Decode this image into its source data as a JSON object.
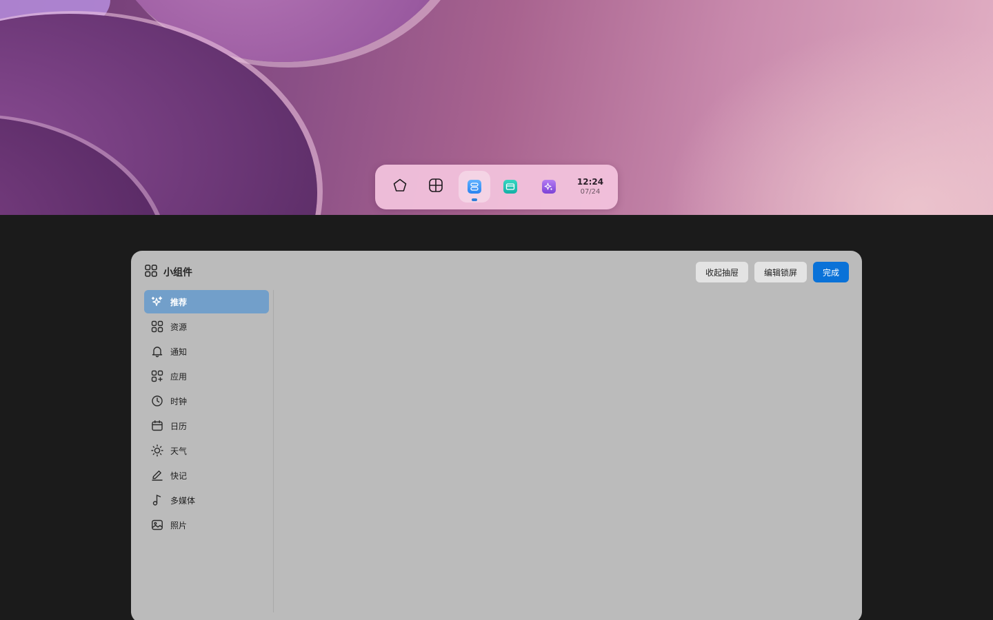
{
  "dock": {
    "items": [
      {
        "icon": "pentagon-icon"
      },
      {
        "icon": "grid-icon"
      },
      {
        "icon": "widgets-icon",
        "active": true
      },
      {
        "icon": "card-icon"
      },
      {
        "icon": "sparkle-icon"
      }
    ],
    "clock": {
      "time": "12:24",
      "date": "07/24"
    }
  },
  "panel": {
    "title": "小组件",
    "actions": {
      "collapse_label": "收起抽屉",
      "edit_lock_label": "编辑锁屏",
      "done_label": "完成"
    },
    "sidebar": {
      "items": [
        {
          "label": "推荐",
          "icon": "sparkle-icon",
          "active": true
        },
        {
          "label": "资源",
          "icon": "grid-icon"
        },
        {
          "label": "通知",
          "icon": "bell-icon"
        },
        {
          "label": "应用",
          "icon": "apps-add-icon"
        },
        {
          "label": "时钟",
          "icon": "clock-icon"
        },
        {
          "label": "日历",
          "icon": "calendar-icon"
        },
        {
          "label": "天气",
          "icon": "sun-icon"
        },
        {
          "label": "快记",
          "icon": "pen-icon"
        },
        {
          "label": "多媒体",
          "icon": "music-note-icon"
        },
        {
          "label": "照片",
          "icon": "photo-icon"
        }
      ]
    }
  },
  "colors": {
    "accent": "#0a72d8",
    "sidebar_active": "#729fca",
    "panel_bg": "#bbbbbb",
    "desktop_bg": "#1b1b1b"
  }
}
